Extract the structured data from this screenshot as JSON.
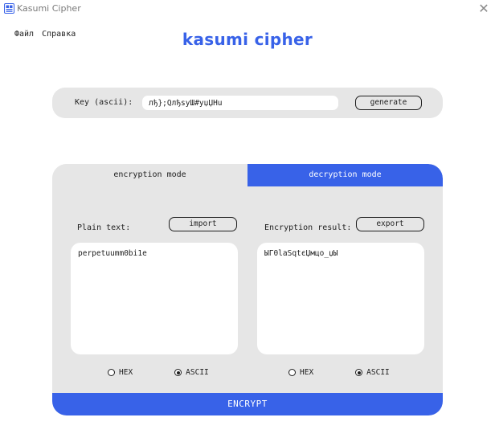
{
  "window": {
    "title": "Kasumi Cipher",
    "close_glyph": "✕",
    "icon": "app-logo-icon"
  },
  "menu": {
    "items": [
      "Файл",
      "Справка"
    ]
  },
  "app_title": "kasumi cipher",
  "key": {
    "label": "Key (ascii):",
    "value": "лђ};QлђѕуШ#уџЏНu",
    "generate_label": "generate"
  },
  "tabs": {
    "encryption": "encryption mode",
    "decryption": "decryption mode",
    "active": "decryption"
  },
  "left": {
    "label": "Plain text:",
    "button": "import",
    "text": "perpetuumm0bi1e",
    "radio_hex": "HEX",
    "radio_ascii": "ASCII",
    "selected": "ASCII"
  },
  "right": {
    "label": "Encryption result:",
    "button": "export",
    "text": "ЫГ0laSqtєЏмцо_џЫ",
    "radio_hex": "HEX",
    "radio_ascii": "ASCII",
    "selected": "ASCII"
  },
  "encrypt_label": "ENCRYPT",
  "colors": {
    "accent": "#3862e8",
    "panel": "#e6e6e6",
    "text": "#1e1e1e"
  }
}
